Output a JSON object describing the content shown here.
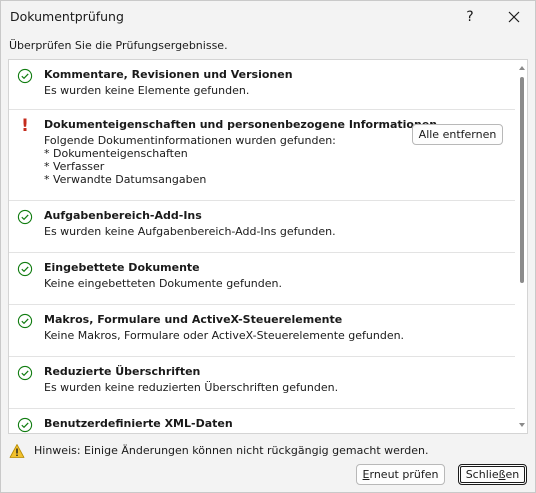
{
  "window": {
    "title": "Dokumentprüfung",
    "help_label": "?"
  },
  "instruction": "Überprüfen Sie die Prüfungsergebnisse.",
  "results": [
    {
      "status": "ok",
      "icon": "check-circle-icon",
      "heading": "Kommentare, Revisionen und Versionen",
      "lines": [
        "Es wurden keine Elemente gefunden."
      ]
    },
    {
      "status": "issue",
      "icon": "exclamation-icon",
      "heading": "Dokumenteigenschaften und personenbezogene Informationen",
      "lines": [
        "Folgende Dokumentinformationen wurden gefunden:",
        "* Dokumenteigenschaften",
        "* Verfasser",
        "* Verwandte Datumsangaben"
      ],
      "action_label": "Alle entfernen"
    },
    {
      "status": "ok",
      "icon": "check-circle-icon",
      "heading": "Aufgabenbereich-Add-Ins",
      "lines": [
        "Es wurden keine Aufgabenbereich-Add-Ins gefunden."
      ]
    },
    {
      "status": "ok",
      "icon": "check-circle-icon",
      "heading": "Eingebettete Dokumente",
      "lines": [
        "Keine eingebetteten Dokumente gefunden."
      ]
    },
    {
      "status": "ok",
      "icon": "check-circle-icon",
      "heading": "Makros, Formulare und ActiveX-Steuerelemente",
      "lines": [
        "Keine Makros, Formulare oder ActiveX-Steuerelemente gefunden."
      ]
    },
    {
      "status": "ok",
      "icon": "check-circle-icon",
      "heading": "Reduzierte Überschriften",
      "lines": [
        "Es wurden keine reduzierten Überschriften gefunden."
      ]
    },
    {
      "status": "ok",
      "icon": "check-circle-icon",
      "heading": "Benutzerdefinierte XML-Daten",
      "lines": []
    }
  ],
  "note": {
    "icon": "warning-triangle-icon",
    "text": "Hinweis: Einige Änderungen können nicht rückgängig gemacht werden."
  },
  "buttons": {
    "recheck_accel": "E",
    "recheck_rest": "rneut prüfen",
    "close_pre": "Schlie",
    "close_accel": "ß",
    "close_post": "en"
  },
  "colors": {
    "ok_green": "#107c10",
    "issue_red": "#c42b1c",
    "warning_yellow": "#f2c12e"
  }
}
